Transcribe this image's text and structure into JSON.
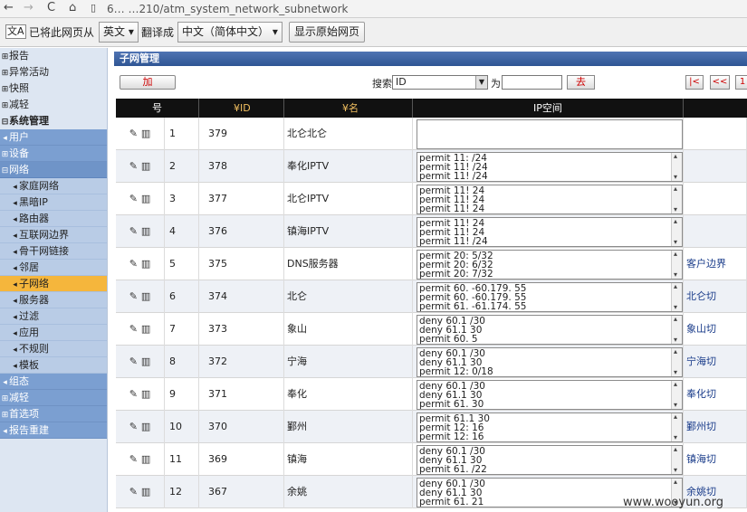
{
  "browser": {
    "back": "←",
    "forward": "→",
    "refresh": "C",
    "home": "⌂",
    "url": "6…  …210/atm_system_network_subnetwork"
  },
  "translate_bar": {
    "icon": "文A",
    "prefix": "已将此网页从",
    "from_lang": "英文 ▾",
    "middle": "翻译成",
    "to_lang": "中文（简体中文） ▾",
    "show_original": "显示原始网页"
  },
  "sidebar": {
    "items": [
      {
        "label": "报告",
        "mark": "⊞",
        "style": "plain"
      },
      {
        "label": "异常活动",
        "mark": "⊞",
        "style": "plain"
      },
      {
        "label": "快照",
        "mark": "⊞",
        "style": "plain"
      },
      {
        "label": "减轻",
        "mark": "⊞",
        "style": "plain"
      },
      {
        "label": "系统管理",
        "mark": "⊟",
        "style": "bold"
      },
      {
        "label": "用户",
        "mark": "◂",
        "style": "band"
      },
      {
        "label": "设备",
        "mark": "⊞",
        "style": "band"
      },
      {
        "label": "网络",
        "mark": "⊟",
        "style": "band2"
      },
      {
        "label": "家庭网络",
        "mark": "◂",
        "style": "sub"
      },
      {
        "label": "黑暗IP",
        "mark": "◂",
        "style": "sub"
      },
      {
        "label": "路由器",
        "mark": "◂",
        "style": "sub"
      },
      {
        "label": "互联网边界",
        "mark": "◂",
        "style": "sub"
      },
      {
        "label": "骨干网链接",
        "mark": "◂",
        "style": "sub"
      },
      {
        "label": "邻居",
        "mark": "◂",
        "style": "sub"
      },
      {
        "label": "子网络",
        "mark": "◂",
        "style": "sub active"
      },
      {
        "label": "服务器",
        "mark": "◂",
        "style": "sub"
      },
      {
        "label": "过滤",
        "mark": "◂",
        "style": "sub"
      },
      {
        "label": "应用",
        "mark": "◂",
        "style": "sub"
      },
      {
        "label": "不规则",
        "mark": "◂",
        "style": "sub"
      },
      {
        "label": "模板",
        "mark": "◂",
        "style": "sub"
      },
      {
        "label": "组态",
        "mark": "◂",
        "style": "band"
      },
      {
        "label": "减轻",
        "mark": "⊞",
        "style": "band"
      },
      {
        "label": "首选项",
        "mark": "⊞",
        "style": "band"
      },
      {
        "label": "报告重建",
        "mark": "◂",
        "style": "band"
      }
    ]
  },
  "main": {
    "section_title": "子网管理",
    "add_label": "加",
    "search_label": "搜索",
    "search_field": "ID",
    "for_label": "为",
    "go_label": "去",
    "pager": [
      "|<",
      "<<",
      "1"
    ]
  },
  "table": {
    "headers": {
      "num": "号",
      "id": "¥ID",
      "name": "¥名",
      "ip": "IP空间"
    },
    "rows": [
      {
        "num": "1",
        "id": "379",
        "name": "北仑北仑",
        "ip": [],
        "extra": ""
      },
      {
        "num": "2",
        "id": "378",
        "name": "奉化IPTV",
        "ip": [
          "permit 11:              /24",
          "permit 11!              /24",
          "permit 11!              /24"
        ],
        "extra": ""
      },
      {
        "num": "3",
        "id": "377",
        "name": "北仑IPTV",
        "ip": [
          "permit 11!              24",
          "permit 11!              24",
          "permit 11!              24"
        ],
        "extra": ""
      },
      {
        "num": "4",
        "id": "376",
        "name": "镇海IPTV",
        "ip": [
          "permit 11!              24",
          "permit 11!              24",
          "permit 11!              /24"
        ],
        "extra": ""
      },
      {
        "num": "5",
        "id": "375",
        "name": "DNS服务器",
        "ip": [
          "permit 20:              5/32",
          "permit 20:              6/32",
          "permit 20:              7/32"
        ],
        "extra": "客户边界"
      },
      {
        "num": "6",
        "id": "374",
        "name": "北仑",
        "ip": [
          "permit 60.          -60.179.        55",
          "permit 60.          -60.179.        55",
          "permit 61.          -61.174.        55"
        ],
        "extra": "北仑切"
      },
      {
        "num": "7",
        "id": "373",
        "name": "象山",
        "ip": [
          "deny 60.1              /30",
          "deny 61.1              30",
          "permit 60.              5"
        ],
        "extra": "象山切"
      },
      {
        "num": "8",
        "id": "372",
        "name": "宁海",
        "ip": [
          "deny 60.1              /30",
          "deny 61.1              30",
          "permit 12:              0/18"
        ],
        "extra": "宁海切"
      },
      {
        "num": "9",
        "id": "371",
        "name": "奉化",
        "ip": [
          "deny 60.1              /30",
          "deny 61.1              30",
          "permit 61.              30"
        ],
        "extra": "奉化切"
      },
      {
        "num": "10",
        "id": "370",
        "name": "鄞州",
        "ip": [
          "permit 61.1              30",
          "permit 12:              16",
          "permit 12:              16"
        ],
        "extra": "鄞州切"
      },
      {
        "num": "11",
        "id": "369",
        "name": "镇海",
        "ip": [
          "deny 60.1              /30",
          "deny 61.1              30",
          "permit 61.              /22"
        ],
        "extra": "镇海切"
      },
      {
        "num": "12",
        "id": "367",
        "name": "余姚",
        "ip": [
          "deny 60.1              /30",
          "deny 61.1              30",
          "permit 61.              21"
        ],
        "extra": "余姚切"
      }
    ]
  },
  "watermark": "www.wooyun.org"
}
